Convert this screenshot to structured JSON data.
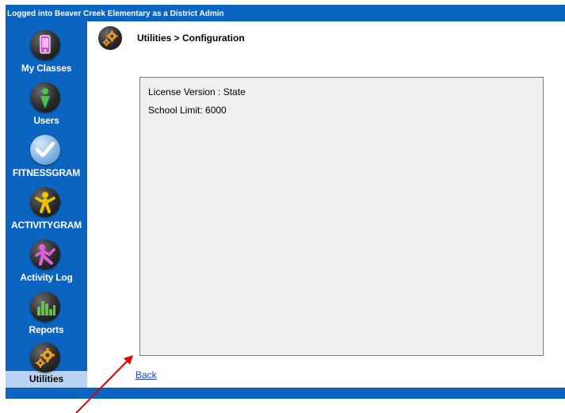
{
  "header": {
    "login_text": "Logged into Beaver Creek Elementary as a District Admin"
  },
  "sidebar": {
    "items": [
      {
        "label": "My Classes",
        "icon": "my-classes-icon",
        "color": "#c040c0"
      },
      {
        "label": "Users",
        "icon": "users-icon",
        "color": "#3cb043"
      },
      {
        "label": "FITNESSGRAM",
        "icon": "fitnessgram-icon",
        "color": "#6fa8dc"
      },
      {
        "label": "ACTIVITYGRAM",
        "icon": "activitygram-icon",
        "color": "#f2c200"
      },
      {
        "label": "Activity Log",
        "icon": "activity-log-icon",
        "color": "#c040c0"
      },
      {
        "label": "Reports",
        "icon": "reports-icon",
        "color": "#3cb043"
      },
      {
        "label": "Utilities",
        "icon": "utilities-icon",
        "color": "#f0a020",
        "active": true
      }
    ]
  },
  "main": {
    "breadcrumb": "Utilities > Configuration",
    "license_version": "License Version : State",
    "school_limit": "School Limit: 6000",
    "back_label": "Back"
  },
  "colors": {
    "frame_blue": "#0b64c0",
    "active_highlight": "#b8d4f2",
    "panel_bg": "#f0f0f0",
    "link": "#1a3fd0",
    "annotation_arrow": "#e00000"
  }
}
